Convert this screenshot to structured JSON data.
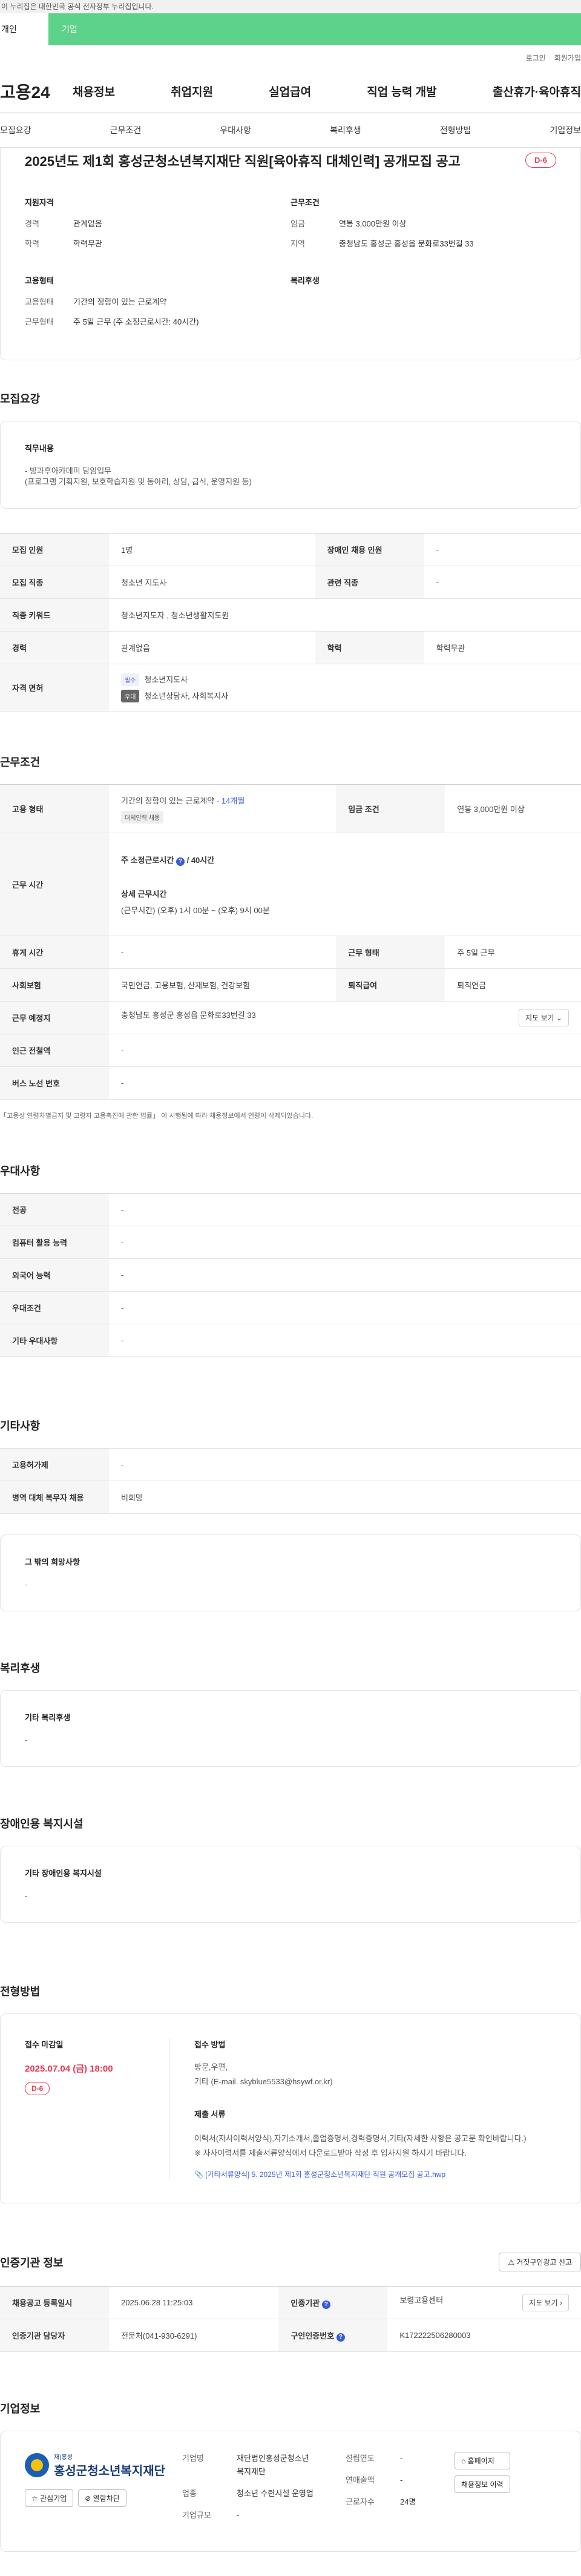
{
  "banner": {
    "text": "이 누리집은 대한민국 공식 전자정부 누리집입니다."
  },
  "site_tabs": [
    "개인",
    "기업"
  ],
  "util": {
    "login": "로그인",
    "join": "회원가입"
  },
  "logo": "고용24",
  "gnb": [
    "채용정보",
    "취업지원",
    "실업급여",
    "직업 능력 개발",
    "출산휴가·육아휴직"
  ],
  "subnav": [
    "모집요강",
    "근무조건",
    "우대사항",
    "복리후생",
    "전형방법",
    "기업정보"
  ],
  "title": "2025년도 제1회 홍성군청소년복지재단 직원[육아휴직 대체인력] 공개모집 공고",
  "dday": "D-6",
  "summary": {
    "qual_h": "지원자격",
    "qual": [
      {
        "k": "경력",
        "v": "관계없음"
      },
      {
        "k": "학력",
        "v": "학력무관"
      }
    ],
    "work_h": "근무조건",
    "work": [
      {
        "k": "임금",
        "v": "연봉 3,000만원 이상"
      },
      {
        "k": "지역",
        "v": "충청남도 홍성군 홍성읍 문화로33번길 33"
      }
    ],
    "emp_h": "고용형태",
    "emp": [
      {
        "k": "고용형태",
        "v": "기간의 정함이 있는 근로계약"
      },
      {
        "k": "근무형태",
        "v": "주 5일 근무 (주 소정근로시간: 40시간)"
      }
    ],
    "welfare_h": "복리후생"
  },
  "recruit": {
    "title": "모집요강",
    "duty_h": "직무내용",
    "duty_t1": "- 방과후아카데미 담임업무",
    "duty_t2": "(프로그램 기획지원, 보호학습지원 및 동아리, 상담, 급식, 운영지원 등)",
    "rows": {
      "count_k": "모집 인원",
      "count_v": "1명",
      "disabled_k": "장애인 채용 인원",
      "disabled_v": "-",
      "job_k": "모집 직종",
      "job_v": "청소년 지도사",
      "rel_k": "관련 직종",
      "rel_v": "-",
      "kw_k": "직종 키워드",
      "kw_v": "청소년지도자 , 청소년생활지도원",
      "career_k": "경력",
      "career_v": "관계없음",
      "edu_k": "학력",
      "edu_v": "학력무관",
      "lic_k": "자격 면허",
      "lic_tag1": "필수",
      "lic_v1": "청소년지도사",
      "lic_tag2": "우대",
      "lic_v2": "청소년상담사, 사회복지사"
    }
  },
  "condition": {
    "title": "근무조건",
    "emp_k": "고용 형태",
    "emp_v": "기간의 정함이 있는 근로계약 · ",
    "emp_months": "14개월",
    "emp_tag": "대체인력 채용",
    "wage_k": "임금 조건",
    "wage_v": "연봉 3,000만원 이상",
    "hours_k": "근무 시간",
    "hours_main_pre": "주 소정근로시간",
    "hours_main_v": "40시간",
    "hours_detail_h": "상세 근무시간",
    "hours_detail_v": "(근무시간) (오후) 1시 00분 ~ (오후) 9시 00분",
    "rest_k": "휴게 시간",
    "rest_v": "-",
    "form_k": "근무 형태",
    "form_v": "주 5일 근무",
    "ins_k": "사회보험",
    "ins_v": "국민연금, 고용보험, 산재보험, 건강보험",
    "ret_k": "퇴직급여",
    "ret_v": "퇴직연금",
    "place_k": "근무 예정지",
    "place_v": "충청남도 홍성군 홍성읍 문화로33번길 33",
    "map_btn": "지도 보기",
    "subway_k": "인근 전철역",
    "subway_v": "-",
    "bus_k": "버스 노선 번호",
    "bus_v": "-",
    "note": "「고용상 연령차별금지 및 고령자 고용촉진에 관한 법률」 이 시행됨에 따라 채용정보에서 연령이 삭제되었습니다."
  },
  "pref": {
    "title": "우대사항",
    "rows": [
      {
        "k": "전공",
        "v": "-"
      },
      {
        "k": "컴퓨터 활용 능력",
        "v": "-"
      },
      {
        "k": "외국어 능력",
        "v": "-"
      },
      {
        "k": "우대조건",
        "v": "-"
      },
      {
        "k": "기타 우대사항",
        "v": "-"
      }
    ]
  },
  "etc": {
    "title": "기타사항",
    "rows": [
      {
        "k": "고용허가제",
        "v": "-"
      },
      {
        "k": "병역 대체 복무자 채용",
        "v": "비희망"
      }
    ],
    "other_h": "그 밖의 희망사항",
    "other_v": "-"
  },
  "welfare": {
    "title": "복리후생",
    "h": "기타 복리후생",
    "v": "-"
  },
  "disability": {
    "title": "장애인용 복지시설",
    "h": "기타 장애인용 복지시설",
    "v": "-"
  },
  "process": {
    "title": "전형방법",
    "deadline_h": "접수 마감일",
    "deadline_v": "2025.07.04 (금) 18:00",
    "dday": "D-6",
    "method_h": "접수 방법",
    "method_v1": "방문,우편,",
    "method_v2": "기타 (E-mail. skyblue5533@hsywf.or.kr)",
    "docs_h": "제출 서류",
    "docs_v1": "이력서(자사이력서양식),자기소개서,졸업증명서,경력증명서,기타(자세한 사항은 공고문 확인바랍니다.)",
    "docs_v2": "※ 자사이력서를 제출서류양식에서 다운로드받아 작성 후 입사지원 하시기 바랍니다.",
    "file": "[기타서류양식] 5. 2025년 제1회 홍성군청소년복지재단 직원 공개모집 공고.hwp"
  },
  "cert": {
    "title": "인증기관 정보",
    "report_btn": "거짓구인광고 신고",
    "reg_k": "채용공고 등록일시",
    "reg_v": "2025.06.28 11:25:03",
    "org_k": "인증기관",
    "org_v": "보령고용센터",
    "map_btn": "지도 보기",
    "mgr_k": "인증기관 담당자",
    "mgr_v": "전문처(041-930-6291)",
    "no_k": "구인인증번호",
    "no_v": "K172222506280003"
  },
  "company": {
    "title": "기업정보",
    "logo_sub": "재)홍성",
    "logo_name": "홍성군청소년복지재단",
    "fav_btn": "관심기업",
    "block_btn": "열람차단",
    "name_k": "기업명",
    "name_v": "재단법인홍성군청소년복지재단",
    "est_k": "설립연도",
    "est_v": "-",
    "sales_k": "연매출액",
    "sales_v": "-",
    "ind_k": "업종",
    "ind_v": "청소년 수련시설 운영업",
    "emp_k": "근로자수",
    "emp_v": "24명",
    "size_k": "기업규모",
    "size_v": "-",
    "home_btn": "홈페이지",
    "jobs_btn": "채용정보 이력"
  }
}
